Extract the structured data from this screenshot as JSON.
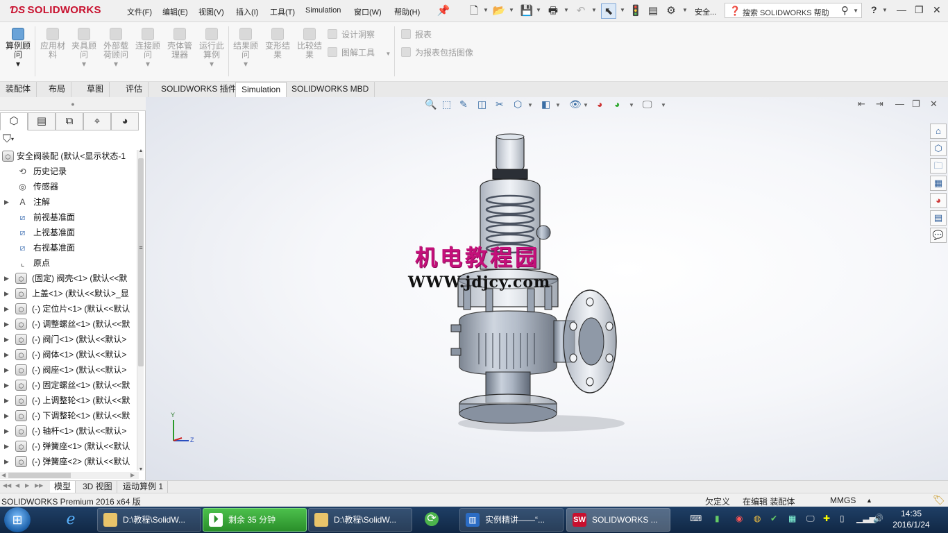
{
  "app": {
    "logo_brand": "SOLIDWORKS",
    "menus": [
      "文件(F)",
      "编辑(E)",
      "视图(V)",
      "插入(I)",
      "工具(T)",
      "Simulation",
      "窗口(W)",
      "帮助(H)"
    ],
    "security_label": "安全...",
    "search_placeholder": "搜索 SOLIDWORKS 帮助",
    "help_label": "?",
    "icons": {
      "new": "new-document-icon",
      "open": "open-folder-icon",
      "save": "save-icon",
      "print": "print-icon",
      "undo": "undo-icon",
      "select": "select-arrow-icon",
      "rebuild": "traffic-light-icon",
      "file_props": "file-properties-icon",
      "options": "gear-icon"
    }
  },
  "ribbon": {
    "buttons": [
      {
        "label": "算例顾问",
        "active": true
      },
      {
        "label": "应用材料",
        "active": false
      },
      {
        "label": "夹具顾问",
        "active": false
      },
      {
        "label": "外部载荷顾问",
        "active": false
      },
      {
        "label": "连接顾问",
        "active": false
      },
      {
        "label": "壳体管理器",
        "active": false
      },
      {
        "label": "运行此算例",
        "active": false
      },
      {
        "label": "结果顾问",
        "active": false
      },
      {
        "label": "变形结果",
        "active": false
      },
      {
        "label": "比较结果",
        "active": false
      }
    ],
    "small_buttons": [
      "设计洞察",
      "图解工具",
      "报表",
      "为报表包括图像"
    ]
  },
  "command_tabs": {
    "items": [
      "装配体",
      "布局",
      "草图",
      "评估",
      "SOLIDWORKS 插件",
      "Simulation",
      "SOLIDWORKS MBD"
    ],
    "active": "Simulation"
  },
  "featuremanager": {
    "root": "安全阀装配 (默认<显示状态-1",
    "nodes": [
      {
        "label": "历史记录",
        "icon": "history-icon",
        "expand": false
      },
      {
        "label": "传感器",
        "icon": "sensor-icon",
        "expand": false
      },
      {
        "label": "注解",
        "icon": "annotation-icon",
        "expand": true
      },
      {
        "label": "前视基准面",
        "icon": "plane-icon",
        "expand": false
      },
      {
        "label": "上视基准面",
        "icon": "plane-icon",
        "expand": false
      },
      {
        "label": "右视基准面",
        "icon": "plane-icon",
        "expand": false
      },
      {
        "label": "原点",
        "icon": "origin-icon",
        "expand": false
      },
      {
        "label": "(固定) 阀壳<1> (默认<<默",
        "icon": "part-icon",
        "expand": true
      },
      {
        "label": "上盖<1> (默认<<默认>_显",
        "icon": "part-icon",
        "expand": true
      },
      {
        "label": "(-) 定位片<1> (默认<<默认",
        "icon": "part-icon",
        "expand": true
      },
      {
        "label": "(-) 调整螺丝<1> (默认<<默",
        "icon": "part-icon",
        "expand": true
      },
      {
        "label": "(-) 阀门<1> (默认<<默认>",
        "icon": "part-icon",
        "expand": true
      },
      {
        "label": "(-) 阀体<1> (默认<<默认>",
        "icon": "part-icon",
        "expand": true
      },
      {
        "label": "(-) 阀座<1> (默认<<默认>",
        "icon": "part-icon",
        "expand": true
      },
      {
        "label": "(-) 固定螺丝<1> (默认<<默",
        "icon": "part-icon",
        "expand": true
      },
      {
        "label": "(-) 上调整轮<1> (默认<<默",
        "icon": "part-icon",
        "expand": true
      },
      {
        "label": "(-) 下调整轮<1> (默认<<默",
        "icon": "part-icon",
        "expand": true
      },
      {
        "label": "(-) 轴杆<1> (默认<<默认>",
        "icon": "part-icon",
        "expand": true
      },
      {
        "label": "(-) 弹簧座<1> (默认<<默认",
        "icon": "part-icon",
        "expand": true
      },
      {
        "label": "(-) 弹簧座<2> (默认<<默认",
        "icon": "part-icon",
        "expand": true
      }
    ]
  },
  "graphics": {
    "watermark_cn": "机电教程园",
    "watermark_url": "WWW.jdjcy.com",
    "triad_y": "Y",
    "triad_z": "Z",
    "colors": {
      "model_line": "#2a2a2a",
      "model_fill": "#9aa7b8",
      "spring": "#7a8290"
    }
  },
  "model_tabs": {
    "items": [
      "模型",
      "3D 视图",
      "运动算例 1"
    ],
    "active": "模型"
  },
  "status": {
    "product": "SOLIDWORKS Premium 2016 x64 版",
    "state1": "欠定义",
    "state2": "在编辑 装配体",
    "units": "MMGS"
  },
  "taskbar": {
    "items": [
      {
        "label": "",
        "icon": "ie-icon",
        "type": "pin"
      },
      {
        "label": "D:\\教程\\SolidW...",
        "icon": "folder-icon",
        "type": "app"
      },
      {
        "label": "剩余 35 分钟",
        "icon": "recorder-icon",
        "type": "green"
      },
      {
        "label": "D:\\教程\\SolidW...",
        "icon": "folder-icon",
        "type": "app"
      },
      {
        "label": "",
        "icon": "refresh-icon",
        "type": "pin"
      },
      {
        "label": "实例精讲——“...",
        "icon": "ppt-icon",
        "type": "app"
      },
      {
        "label": "SOLIDWORKS ...",
        "icon": "solidworks-icon",
        "type": "app"
      }
    ],
    "time": "14:35",
    "date": "2016/1/24"
  }
}
